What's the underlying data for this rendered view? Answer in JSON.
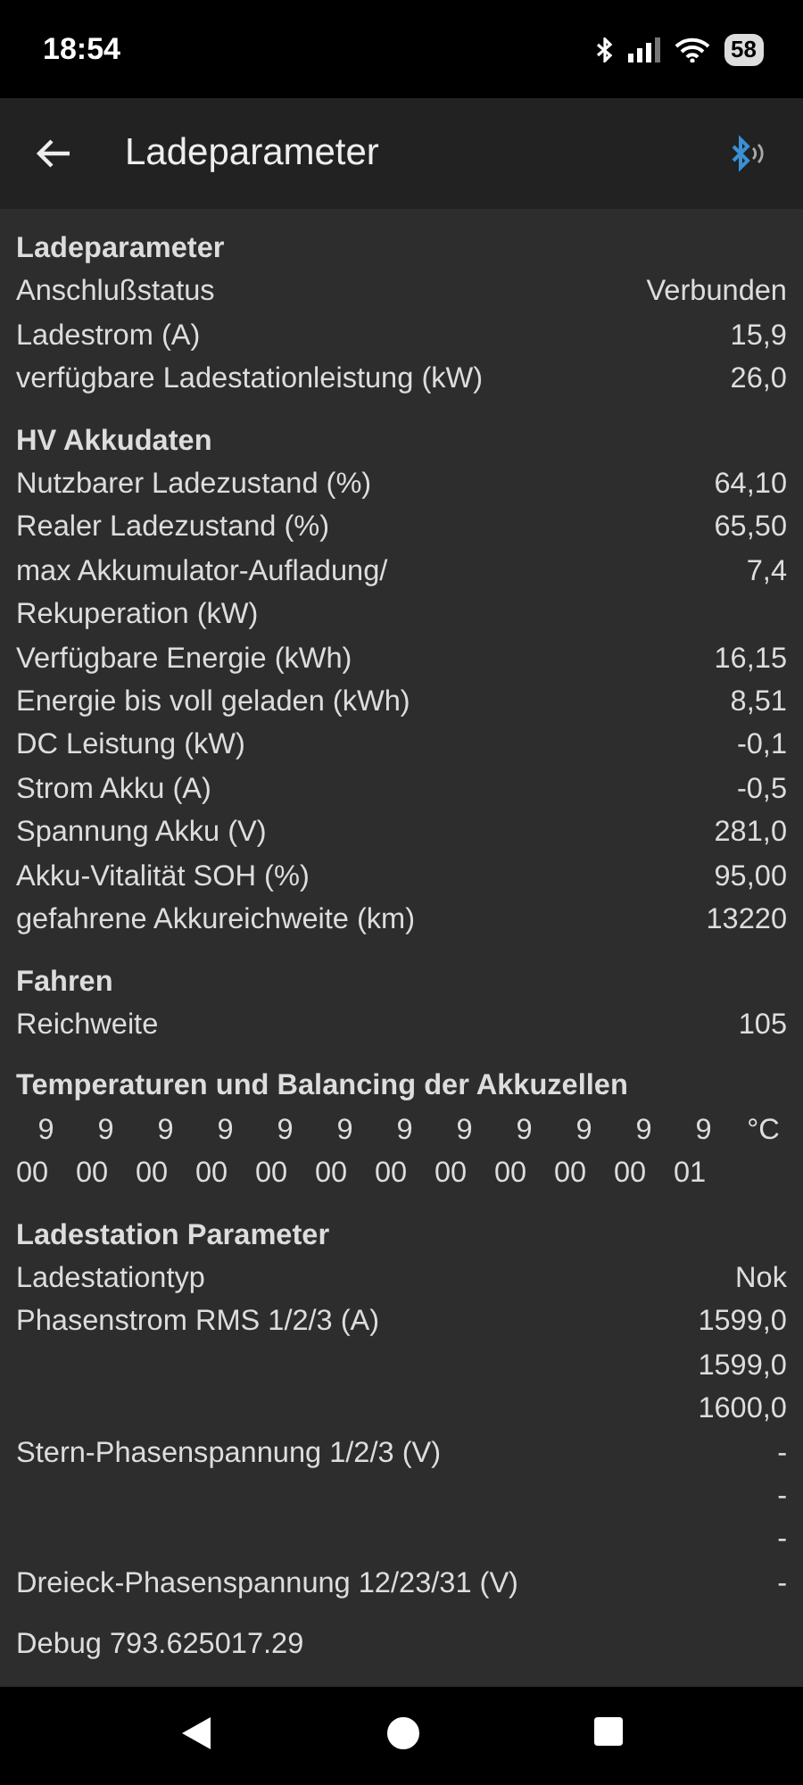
{
  "status_bar": {
    "time": "18:54",
    "battery": "58"
  },
  "app_bar": {
    "title": "Ladeparameter"
  },
  "sections": [
    {
      "title": "Ladeparameter",
      "rows": [
        {
          "label": "Anschlußstatus",
          "values": [
            "Verbunden"
          ]
        },
        {
          "label": "Ladestrom (A)",
          "values": [
            "15,9"
          ]
        },
        {
          "label": "verfügbare Ladestationleistung (kW)",
          "values": [
            "26,0"
          ]
        }
      ]
    },
    {
      "title": "HV Akkudaten",
      "rows": [
        {
          "label": "Nutzbarer Ladezustand (%)",
          "values": [
            "64,10"
          ]
        },
        {
          "label": "Realer Ladezustand (%)",
          "values": [
            "65,50"
          ]
        },
        {
          "label": "max Akkumulator-Aufladung/ Rekuperation (kW)",
          "values": [
            "7,4"
          ]
        },
        {
          "label": "Verfügbare Energie (kWh)",
          "values": [
            "16,15"
          ]
        },
        {
          "label": "Energie bis voll geladen (kWh)",
          "values": [
            "8,51"
          ]
        },
        {
          "label": "DC Leistung (kW)",
          "values": [
            "-0,1"
          ]
        },
        {
          "label": "Strom Akku (A)",
          "values": [
            "-0,5"
          ]
        },
        {
          "label": "Spannung Akku (V)",
          "values": [
            "281,0"
          ]
        },
        {
          "label": "Akku-Vitalität SOH (%)",
          "values": [
            "95,00"
          ]
        },
        {
          "label": "gefahrene Akkureichweite (km)",
          "values": [
            "13220"
          ]
        }
      ]
    },
    {
      "title": "Fahren",
      "rows": [
        {
          "label": "Reichweite",
          "values": [
            "105"
          ]
        }
      ]
    },
    {
      "title": "Temperaturen und Balancing der Akkuzellen",
      "temperatures": [
        "9",
        "9",
        "9",
        "9",
        "9",
        "9",
        "9",
        "9",
        "9",
        "9",
        "9",
        "9"
      ],
      "unit": "°C",
      "balancing": [
        "00",
        "00",
        "00",
        "00",
        "00",
        "00",
        "00",
        "00",
        "00",
        "00",
        "00",
        "01"
      ]
    },
    {
      "title": "Ladestation Parameter",
      "rows": [
        {
          "label": "Ladestationtyp",
          "values": [
            "Nok"
          ]
        },
        {
          "label": "Phasenstrom RMS 1/2/3 (A)",
          "values": [
            "1599,0",
            "1599,0",
            "1600,0"
          ]
        },
        {
          "label": "Stern-Phasenspannung 1/2/3 (V)",
          "values": [
            "-",
            "-",
            "-"
          ]
        },
        {
          "label": "Dreieck-Phasenspannung 12/23/31 (V)",
          "values": [
            "-"
          ]
        }
      ]
    }
  ],
  "debug": "Debug 793.625017.29"
}
